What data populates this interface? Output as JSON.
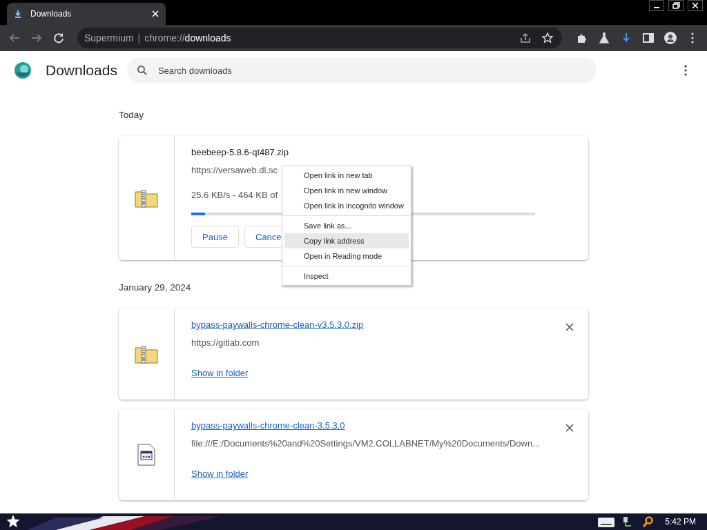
{
  "browser": {
    "tab": {
      "title": "Downloads",
      "selected": true
    },
    "address": {
      "brand": "Supermium",
      "separator": "|",
      "scheme": "chrome://",
      "path": "downloads"
    }
  },
  "header": {
    "title": "Downloads",
    "search": {
      "placeholder": "Search downloads"
    }
  },
  "sections": [
    {
      "date": "Today",
      "items": [
        {
          "kind": "active",
          "file": {
            "kind": "archive"
          },
          "name": "beebeep-5.8.6-qt487.zip",
          "source": "https://versaweb.dl.sc",
          "status": "25.6 KB/s - 464 KB of",
          "level": 0.04,
          "buttons": [
            "Pause",
            "Cance"
          ]
        }
      ]
    },
    {
      "date": "January 29, 2024",
      "items": [
        {
          "kind": "done",
          "file": {
            "kind": "archive"
          },
          "name": "bypass-paywalls-chrome-clean-v3.5.3.0.zip",
          "source": "https://gitlab.com",
          "action": "Show in folder"
        },
        {
          "kind": "done",
          "file": {
            "kind": "document"
          },
          "name": "bypass-paywalls-chrome-clean-3.5.3.0",
          "source": "file:///E:/Documents%20and%20Settings/VM2.COLLABNET/My%20Documents/Down...",
          "action": "Show in folder"
        }
      ]
    }
  ],
  "context_menu": {
    "groups": [
      [
        {
          "label": "Open link in new tab",
          "selected": false
        },
        {
          "label": "Open link in new window",
          "selected": false
        },
        {
          "label": "Open link in incognito window",
          "selected": false
        }
      ],
      [
        {
          "label": "Save link as...",
          "selected": false
        },
        {
          "label": "Copy link address",
          "selected": true
        },
        {
          "label": "Open in Reading mode",
          "selected": false
        }
      ],
      [
        {
          "label": "Inspect",
          "selected": false
        }
      ]
    ]
  },
  "taskbar": {
    "time": "5:42 PM"
  }
}
